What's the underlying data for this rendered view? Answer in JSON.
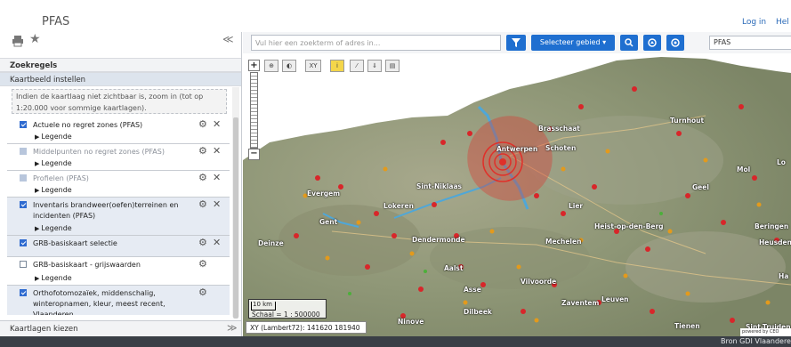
{
  "header": {
    "title": "PFAS",
    "login_label": "Log in",
    "help_label": "Hel"
  },
  "left_panel": {
    "zoekregels_label": "Zoekregels",
    "kaartbeeld_label": "Kaartbeeld instellen",
    "hint_text": "Indien de kaartlaag niet zichtbaar is, zoom in (tot op 1:20.000 voor sommige kaartlagen).",
    "legend_label": "Legende",
    "layers": [
      {
        "title": "Actuele no regret zones (PFAS)",
        "checked": true,
        "dim": false,
        "legend": true
      },
      {
        "title": "Middelpunten no regret zones (PFAS)",
        "checked": true,
        "dim": true,
        "legend": true
      },
      {
        "title": "Profielen (PFAS)",
        "checked": true,
        "dim": true,
        "legend": true
      },
      {
        "title": "Inventaris brandweer(oefen)terreinen en incidenten (PFAS)",
        "checked": true,
        "dim": false,
        "legend": true
      },
      {
        "title": "GRB-basiskaart selectie",
        "checked": true,
        "dim": false,
        "legend": false
      },
      {
        "title": "GRB-basiskaart - grijswaarden",
        "checked": false,
        "dim": false,
        "legend": true
      },
      {
        "title": "Orthofotomozaïek, middenschalig, winteropnamen, kleur, meest recent, Vlaanderen",
        "checked": true,
        "dim": false,
        "legend": false
      }
    ],
    "kaartlagen_label": "Kaartlagen kiezen"
  },
  "search": {
    "placeholder": "Vul hier een zoekterm of adres in...",
    "gebied_label": "Selecteer gebied",
    "layer_select_value": "PFAS"
  },
  "map": {
    "tool_labels": [
      "XY"
    ],
    "places": [
      {
        "name": "Brasschaat"
      },
      {
        "name": "Antwerpen"
      },
      {
        "name": "Schoten"
      },
      {
        "name": "Turnhout"
      },
      {
        "name": "Sint-Niklaas"
      },
      {
        "name": "Evergem"
      },
      {
        "name": "Lokeren"
      },
      {
        "name": "Gent"
      },
      {
        "name": "Lier"
      },
      {
        "name": "Geel"
      },
      {
        "name": "Mol"
      },
      {
        "name": "Heist-op-den-Berg"
      },
      {
        "name": "Beringen"
      },
      {
        "name": "Deinze"
      },
      {
        "name": "Dendermonde"
      },
      {
        "name": "Mechelen"
      },
      {
        "name": "Heusden"
      },
      {
        "name": "Aalst"
      },
      {
        "name": "Vilvoorde"
      },
      {
        "name": "Asse"
      },
      {
        "name": "Zaventem"
      },
      {
        "name": "Leuven"
      },
      {
        "name": "Dilbeek"
      },
      {
        "name": "Ninove"
      },
      {
        "name": "Tienen"
      },
      {
        "name": "Sint-Truiden"
      },
      {
        "name": "Lo"
      },
      {
        "name": "Ha"
      }
    ],
    "scale_km": "10 km",
    "scale_ratio": "Schaal = 1 : 500000",
    "coords": "XY (Lambert72): 141620 181940",
    "powered_by": "powered by CEO",
    "source": "Bron GDI Vlaanderen"
  },
  "colors": {
    "accent": "#1f6fd0",
    "zone_red": "#e0302a",
    "incident_orange": "#e39a1c"
  }
}
